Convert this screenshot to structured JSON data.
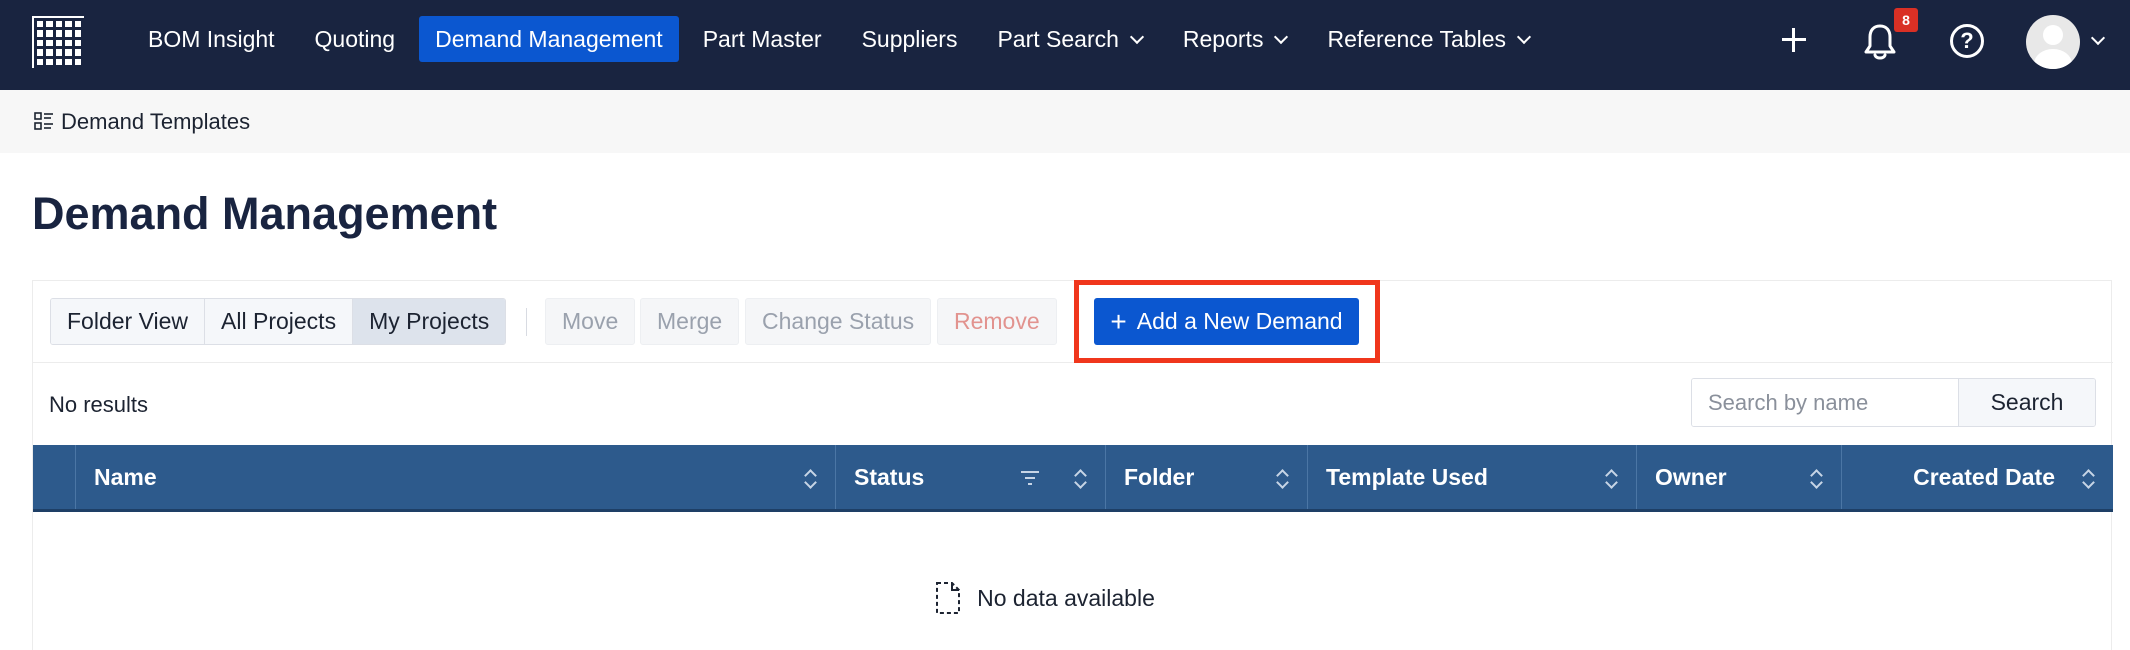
{
  "nav": {
    "items": [
      {
        "label": "BOM Insight",
        "active": false,
        "dropdown": false
      },
      {
        "label": "Quoting",
        "active": false,
        "dropdown": false
      },
      {
        "label": "Demand Management",
        "active": true,
        "dropdown": false
      },
      {
        "label": "Part Master",
        "active": false,
        "dropdown": false
      },
      {
        "label": "Suppliers",
        "active": false,
        "dropdown": false
      },
      {
        "label": "Part Search",
        "active": false,
        "dropdown": true
      },
      {
        "label": "Reports",
        "active": false,
        "dropdown": true
      },
      {
        "label": "Reference Tables",
        "active": false,
        "dropdown": true
      }
    ],
    "notification_count": "8",
    "help_glyph": "?",
    "colors": {
      "bar": "#192440",
      "active": "#0b57d0",
      "badge": "#d93025"
    }
  },
  "subbar": {
    "label": "Demand Templates"
  },
  "page": {
    "title": "Demand Management"
  },
  "toolbar": {
    "views": [
      {
        "label": "Folder View",
        "selected": false
      },
      {
        "label": "All Projects",
        "selected": false
      },
      {
        "label": "My Projects",
        "selected": true
      }
    ],
    "actions": {
      "move": "Move",
      "merge": "Merge",
      "change_status": "Change Status",
      "remove": "Remove"
    },
    "add_button": {
      "icon": "+",
      "label": "Add a New Demand"
    },
    "highlight_color": "#f0361c"
  },
  "results": {
    "text": "No results"
  },
  "search": {
    "placeholder": "Search by name",
    "value": "",
    "button": "Search"
  },
  "table": {
    "columns": [
      "Name",
      "Status",
      "Folder",
      "Template Used",
      "Owner",
      "Created Date"
    ],
    "header_color": "#2d5a8c",
    "empty_text": "No data available"
  }
}
